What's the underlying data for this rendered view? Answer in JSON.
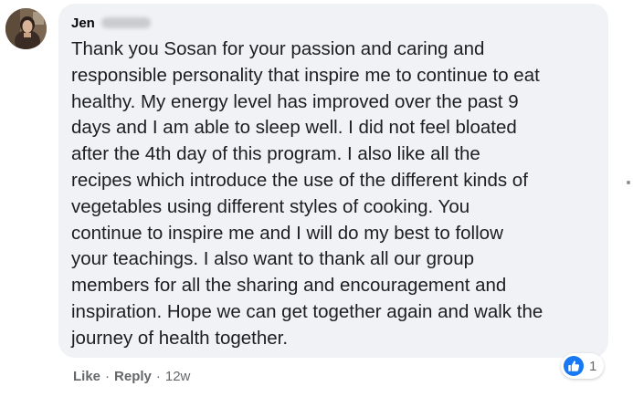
{
  "comment": {
    "author": "Jen",
    "text_lines": [
      "Thank you Sosan for your passion and caring and",
      "responsible personality that inspire me to continue to eat",
      "healthy. My energy level has improved over the past 9",
      "days and I am able to sleep well. I did not feel bloated",
      "after the 4th day of this program. I also like all the",
      "recipes which introduce the use of the different kinds of",
      "vegetables using different styles of cooking. You",
      "continue to inspire me and I will do my best to follow",
      "your teachings. I also want to thank all our group",
      "members for all the sharing and encouragement and",
      "inspiration. Hope we can get together again and walk the",
      "journey of health together."
    ],
    "reactions": {
      "icon": "like-icon",
      "count": "1"
    }
  },
  "actions": {
    "like_label": "Like",
    "separator": "·",
    "reply_label": "Reply",
    "timestamp": "12w"
  },
  "colors": {
    "bubble_bg": "#f0f2f5",
    "text": "#1c1e21",
    "muted": "#65676b",
    "like_blue": "#1877f2"
  }
}
